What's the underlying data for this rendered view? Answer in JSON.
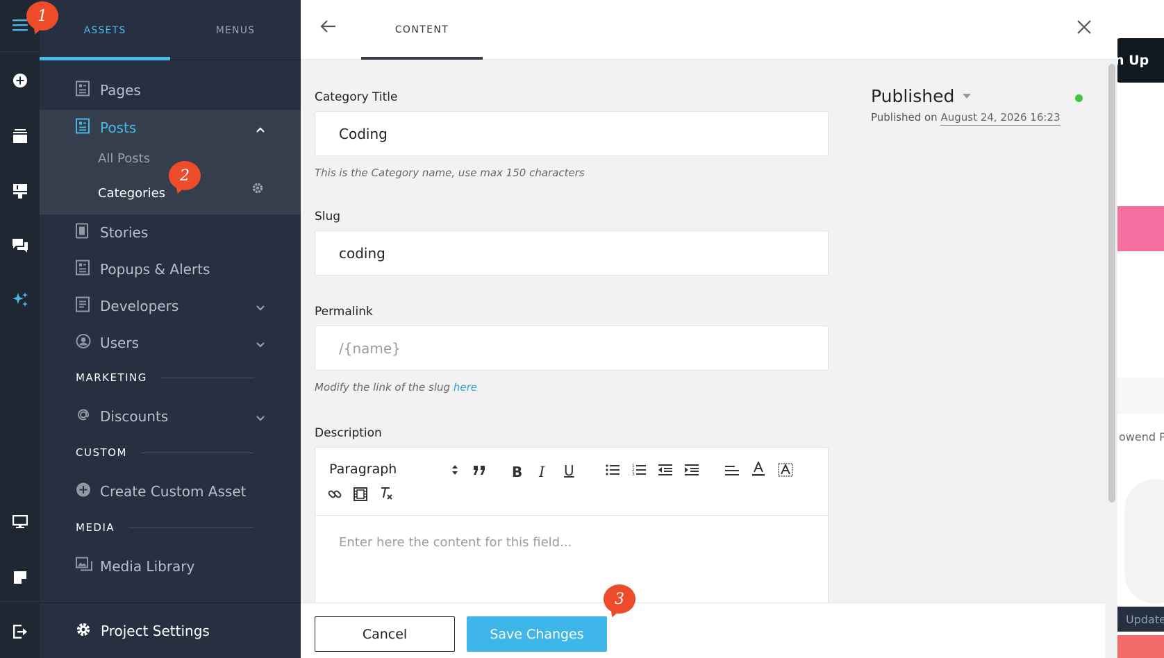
{
  "nav": {
    "tabs": [
      {
        "label": "ASSETS",
        "active": true
      },
      {
        "label": "MENUS",
        "active": false
      }
    ],
    "items": {
      "pages": "Pages",
      "posts": "Posts",
      "all_posts": "All Posts",
      "categories": "Categories",
      "stories": "Stories",
      "popups": "Popups & Alerts",
      "developers": "Developers",
      "users": "Users",
      "discounts": "Discounts",
      "create_custom": "Create Custom Asset",
      "media_library": "Media Library"
    },
    "sections": {
      "marketing": "MARKETING",
      "custom": "CUSTOM",
      "media": "MEDIA"
    },
    "footer": {
      "project_settings": "Project Settings"
    },
    "accent_color": "#4ab8e6"
  },
  "content": {
    "tab": "CONTENT",
    "category_title": {
      "label": "Category Title",
      "value": "Coding",
      "hint": "This is the Category name, use max 150 characters"
    },
    "slug": {
      "label": "Slug",
      "value": "coding"
    },
    "permalink": {
      "label": "Permalink",
      "placeholder": "/{name}",
      "hint": "Modify the link of the slug",
      "hint_link": "here"
    },
    "description": {
      "label": "Description",
      "block_format": "Paragraph",
      "placeholder": "Enter here the content for this field..."
    },
    "status": {
      "value": "Published",
      "published_on_label": "Published on",
      "published_on_date": "August 24, 2026 16:23",
      "indicator_color": "#3fc43f"
    },
    "actions": {
      "cancel": "Cancel",
      "save": "Save Changes"
    }
  },
  "preview": {
    "signup_text": "n Up",
    "text_fragment": "owend P",
    "update_text": "Update"
  },
  "callouts": [
    "1",
    "2",
    "3"
  ],
  "colors": {
    "save_button": "#3fb6ea",
    "callout": "#ee4b2b"
  }
}
